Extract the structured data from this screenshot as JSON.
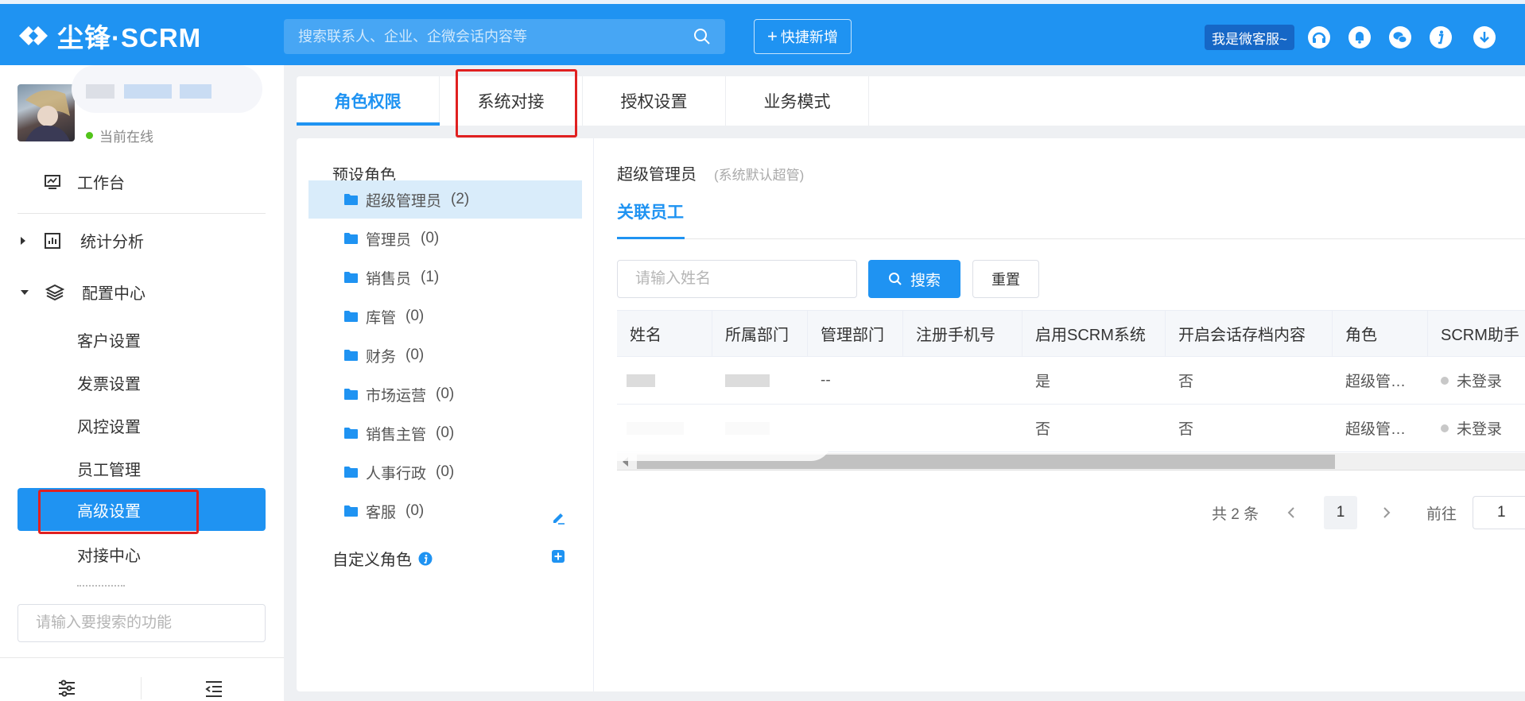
{
  "brand": {
    "name": "尘锋·SCRM",
    "accent": "#1f93f2",
    "alert": "#e02020"
  },
  "topbar": {
    "search_placeholder": "搜索联系人、企业、企微会话内容等",
    "quick_add": "快捷新增",
    "service_badge": "我是微客服~",
    "icons": [
      "headset-icon",
      "bell-icon",
      "wechat-icon",
      "info-icon",
      "download-icon"
    ]
  },
  "user": {
    "status": "当前在线"
  },
  "sidebar": {
    "dashboard": "工作台",
    "analytics": "统计分析",
    "config_center": "配置中心",
    "sub_items": [
      "客户设置",
      "发票设置",
      "风控设置",
      "员工管理"
    ],
    "active_item": "高级设置",
    "after_item": "对接中心",
    "search_placeholder": "请输入要搜索的功能"
  },
  "tabs": [
    "角色权限",
    "系统对接",
    "授权设置",
    "业务模式"
  ],
  "roles": {
    "preset_title": "预设角色",
    "items": [
      {
        "name": "超级管理员",
        "count": "(2)"
      },
      {
        "name": "管理员",
        "count": "(0)"
      },
      {
        "name": "销售员",
        "count": "(1)"
      },
      {
        "name": "库管",
        "count": "(0)"
      },
      {
        "name": "财务",
        "count": "(0)"
      },
      {
        "name": "市场运营",
        "count": "(0)"
      },
      {
        "name": "销售主管",
        "count": "(0)"
      },
      {
        "name": "人事行政",
        "count": "(0)"
      },
      {
        "name": "客服",
        "count": "(0)"
      }
    ],
    "custom_title": "自定义角色"
  },
  "detail": {
    "role_name": "超级管理员",
    "role_note": "(系统默认超管)",
    "sub_tab": "关联员工",
    "name_placeholder": "请输入姓名",
    "search_btn": "搜索",
    "reset_btn": "重置",
    "columns": [
      "姓名",
      "所属部门",
      "管理部门",
      "注册手机号",
      "启用SCRM系统",
      "开启会话存档内容",
      "角色",
      "SCRM助手"
    ],
    "rows": [
      {
        "manage_dept": "--",
        "enabled": "是",
        "archive": "否",
        "role": "超级管…",
        "assistant": "未登录"
      },
      {
        "manage_dept": "",
        "enabled": "否",
        "archive": "否",
        "role": "超级管…",
        "assistant": "未登录"
      }
    ],
    "pager": {
      "total": "共 2 条",
      "current": "1",
      "goto": "前往",
      "goto_value": "1"
    }
  }
}
